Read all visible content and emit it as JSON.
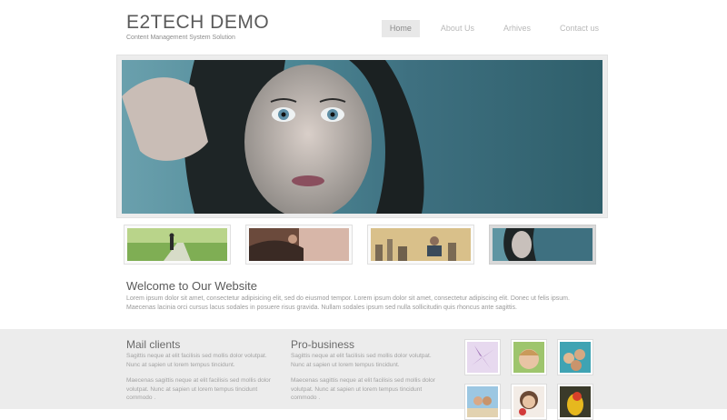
{
  "header": {
    "title": "E2TECH DEMO",
    "subtitle": "Content Management System Solution"
  },
  "nav": {
    "items": [
      {
        "label": "Home",
        "active": true
      },
      {
        "label": "About Us",
        "active": false
      },
      {
        "label": "Arhives",
        "active": false
      },
      {
        "label": "Contact us",
        "active": false
      }
    ]
  },
  "hero": {
    "image": "woman-portrait"
  },
  "thumbnails": [
    {
      "image": "man-walking-park-path",
      "active": false
    },
    {
      "image": "man-in-car",
      "active": false
    },
    {
      "image": "city-skyline-reader",
      "active": false
    },
    {
      "image": "woman-portrait",
      "active": true
    }
  ],
  "welcome": {
    "title": "Welcome to Our Website",
    "body": "Lorem ipsum dolor sit amet, consectetur adipisicing elit, sed do eiusmod tempor. Lorem ipsum dolor sit amet, consectetur adipiscing elit. Donec ut felis ipsum. Maecenas lacinia orci cursus lacus sodales in posuere risus gravida. Nullam sodales ipsum sed nulla sollicitudin quis rhoncus ante sagittis."
  },
  "columns": [
    {
      "title": "Mail clients",
      "p1": "Sagittis neque at elit facilisis sed mollis dolor volutpat. Nunc at sapien ut lorem tempus tincidunt.",
      "p2": "Maecenas sagittis neque at elit facilisis sed mollis dolor volutpat. Nunc at sapien ut lorem tempus tincidunt commodo ."
    },
    {
      "title": "Pro-business",
      "p1": "Sagittis neque at elit facilisis sed mollis dolor volutpat. Nunc at sapien ut lorem tempus tincidunt.",
      "p2": "Maecenas sagittis neque at elit facilisis sed mollis dolor volutpat. Nunc at sapien ut lorem tempus tincidunt commodo ."
    }
  ],
  "gallery": [
    {
      "image": "lily-flower"
    },
    {
      "image": "child-smiling"
    },
    {
      "image": "friends-group"
    },
    {
      "image": "couple-beach"
    },
    {
      "image": "woman-with-flower"
    },
    {
      "image": "parrot"
    }
  ],
  "colors": {
    "hero_teal": "#3d6f7a",
    "band_gray": "#ececec",
    "nav_active_bg": "#e8e8e8"
  }
}
